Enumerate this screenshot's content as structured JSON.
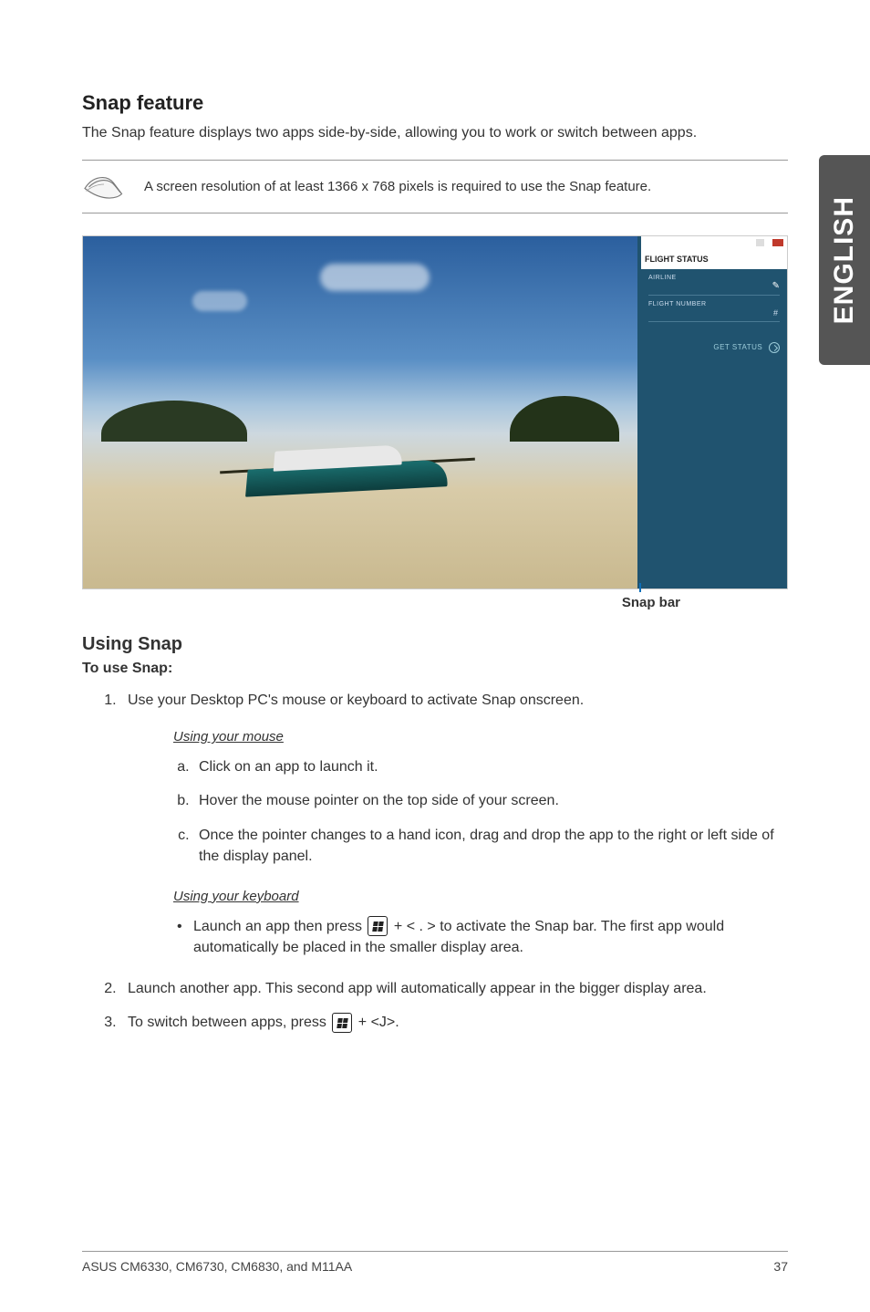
{
  "side_tab": "ENGLISH",
  "section": {
    "title": "Snap feature",
    "intro": "The Snap feature displays two apps side-by-side, allowing you to work or switch between apps.",
    "note": "A screen resolution of at least 1366 x 768 pixels is required to use the Snap feature."
  },
  "snap_pane": {
    "title": "FLIGHT STATUS",
    "field1_label": "AIRLINE",
    "field2_label": "FLIGHT NUMBER",
    "field2_hint": "#",
    "button": "GET STATUS"
  },
  "snap_bar_label": "Snap bar",
  "using_snap": {
    "heading": "Using Snap",
    "to_use": "To use Snap:",
    "step1": "Use your Desktop PC's mouse or keyboard to activate Snap onscreen.",
    "mouse_heading": "Using your mouse",
    "mouse_a": "Click on an app to launch it.",
    "mouse_b": "Hover the mouse pointer on the top side of your screen.",
    "mouse_c": "Once the pointer changes to a hand icon, drag and drop the app to the right or left side of the display panel.",
    "keyboard_heading": "Using your keyboard",
    "keyboard_bullet_pre": "Launch an app then press ",
    "keyboard_bullet_mid": " + < . > to activate the Snap bar. The first app would automatically be placed in the smaller display area.",
    "step2": "Launch another app. This second app will automatically appear in the bigger display area.",
    "step3_pre": "To switch between apps, press ",
    "step3_post": " + <J>."
  },
  "footer": {
    "left": "ASUS CM6330, CM6730, CM6830, and M11AA",
    "right": "37"
  }
}
